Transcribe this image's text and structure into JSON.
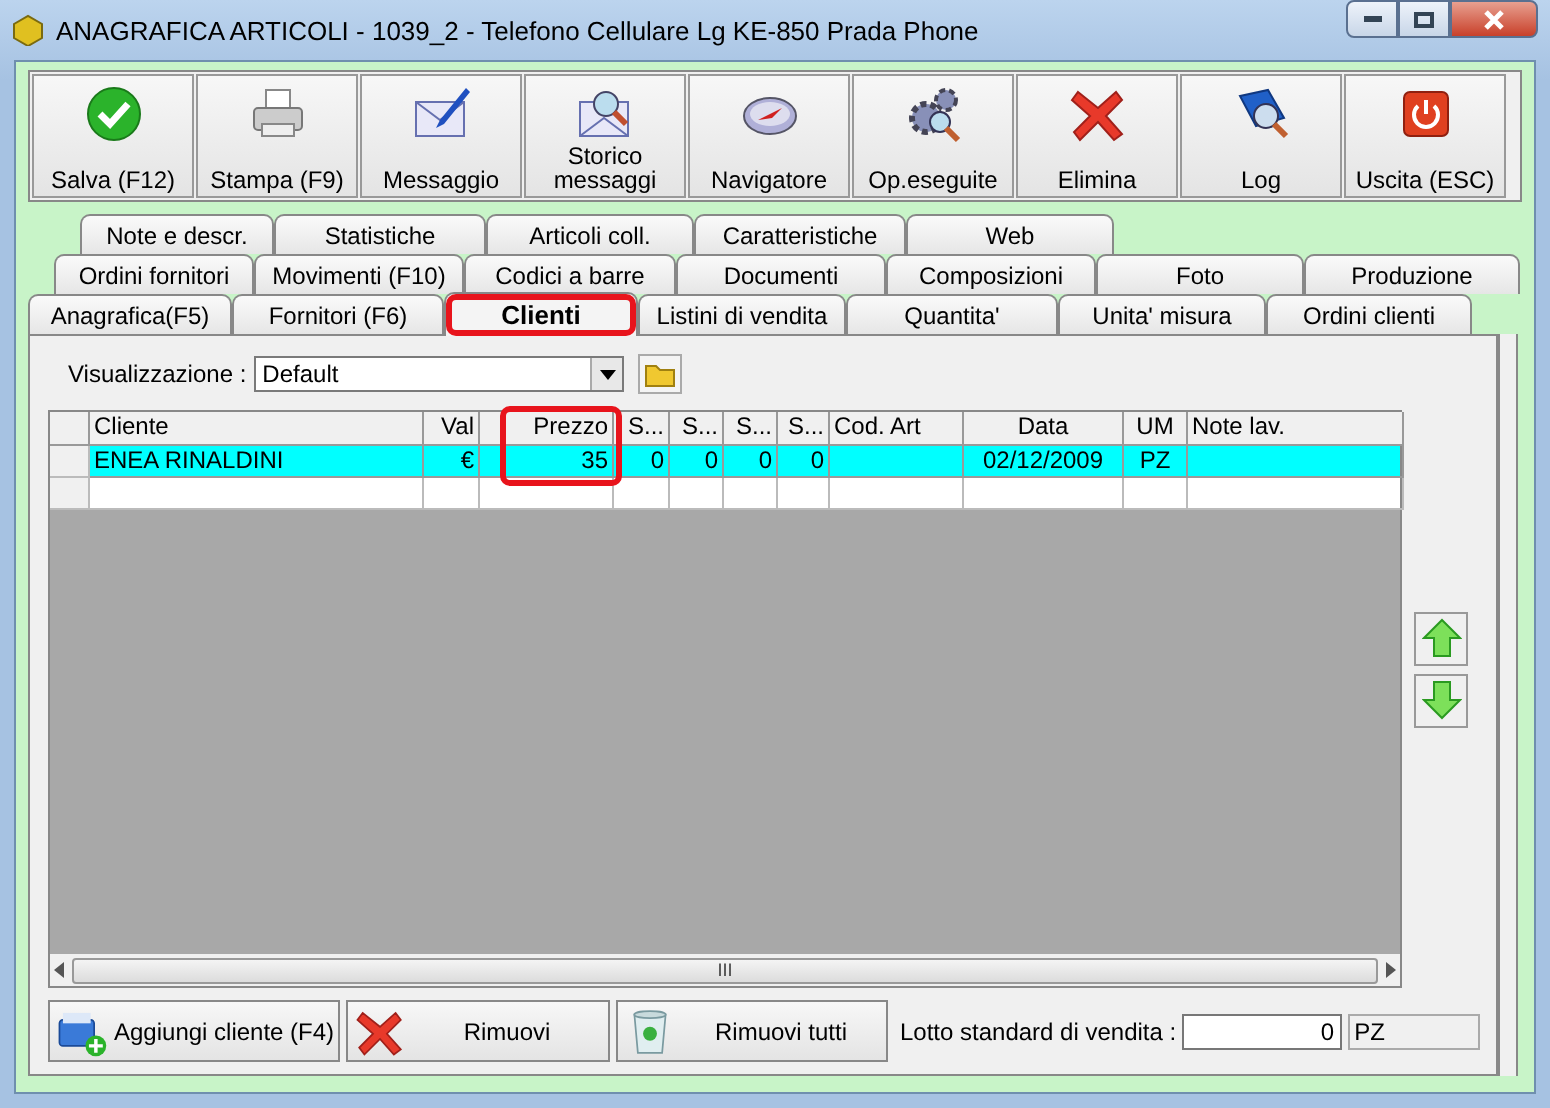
{
  "window": {
    "title": "ANAGRAFICA ARTICOLI - 1039_2 - Telefono Cellulare Lg KE-850 Prada Phone"
  },
  "toolbar": [
    {
      "label": "Salva (F12)",
      "kind": "check"
    },
    {
      "label": "Stampa (F9)",
      "kind": "printer"
    },
    {
      "label": "Messaggio",
      "kind": "mailpen"
    },
    {
      "label": "Storico messaggi",
      "kind": "mailsearch"
    },
    {
      "label": "Navigatore",
      "kind": "compass"
    },
    {
      "label": "Op.eseguite",
      "kind": "gears"
    },
    {
      "label": "Elimina",
      "kind": "cross"
    },
    {
      "label": "Log",
      "kind": "book"
    },
    {
      "label": "Uscita (ESC)",
      "kind": "power"
    }
  ],
  "tab_rows": [
    [
      {
        "label": "Note e descr.",
        "selected": false,
        "highlighted": false
      },
      {
        "label": "Statistiche",
        "selected": false,
        "highlighted": false
      },
      {
        "label": "Articoli coll.",
        "selected": false,
        "highlighted": false
      },
      {
        "label": "Caratteristiche",
        "selected": false,
        "highlighted": false
      },
      {
        "label": "Web",
        "selected": false,
        "highlighted": false
      }
    ],
    [
      {
        "label": "Ordini fornitori",
        "selected": false,
        "highlighted": false
      },
      {
        "label": "Movimenti (F10)",
        "selected": false,
        "highlighted": false
      },
      {
        "label": "Codici a barre",
        "selected": false,
        "highlighted": false
      },
      {
        "label": "Documenti",
        "selected": false,
        "highlighted": false
      },
      {
        "label": "Composizioni",
        "selected": false,
        "highlighted": false
      },
      {
        "label": "Foto",
        "selected": false,
        "highlighted": false
      },
      {
        "label": "Produzione",
        "selected": false,
        "highlighted": false
      }
    ],
    [
      {
        "label": "Anagrafica(F5)",
        "selected": false,
        "highlighted": false
      },
      {
        "label": "Fornitori (F6)",
        "selected": false,
        "highlighted": false
      },
      {
        "label": "Clienti",
        "selected": true,
        "highlighted": true
      },
      {
        "label": "Listini di vendita",
        "selected": false,
        "highlighted": false
      },
      {
        "label": "Quantita'",
        "selected": false,
        "highlighted": false
      },
      {
        "label": "Unita' misura",
        "selected": false,
        "highlighted": false
      },
      {
        "label": "Ordini clienti",
        "selected": false,
        "highlighted": false
      }
    ]
  ],
  "view": {
    "label": "Visualizzazione :",
    "value": "Default"
  },
  "table": {
    "columns": [
      {
        "label": "Cliente",
        "highlighted": false
      },
      {
        "label": "Val",
        "highlighted": false
      },
      {
        "label": "Prezzo",
        "highlighted": true
      },
      {
        "label": "S...",
        "highlighted": false
      },
      {
        "label": "S...",
        "highlighted": false
      },
      {
        "label": "S...",
        "highlighted": false
      },
      {
        "label": "S...",
        "highlighted": false
      },
      {
        "label": "Cod. Art",
        "highlighted": false
      },
      {
        "label": "Data",
        "highlighted": false
      },
      {
        "label": "UM",
        "highlighted": false
      },
      {
        "label": "Note lav.",
        "highlighted": false
      }
    ],
    "rows": [
      {
        "selected": true,
        "cells": [
          "ENEA RINALDINI",
          "€",
          "35",
          "0",
          "0",
          "0",
          "0",
          "",
          "02/12/2009",
          "PZ",
          ""
        ]
      }
    ]
  },
  "scroll_thumb": "III",
  "bottom_buttons": [
    {
      "label": "Aggiungi cliente (F4)",
      "kind": "add"
    },
    {
      "label": "Rimuovi",
      "kind": "cross"
    },
    {
      "label": "Rimuovi tutti",
      "kind": "bin"
    }
  ],
  "lotto": {
    "label": "Lotto standard di vendita :",
    "value": "0",
    "unit": "PZ"
  }
}
